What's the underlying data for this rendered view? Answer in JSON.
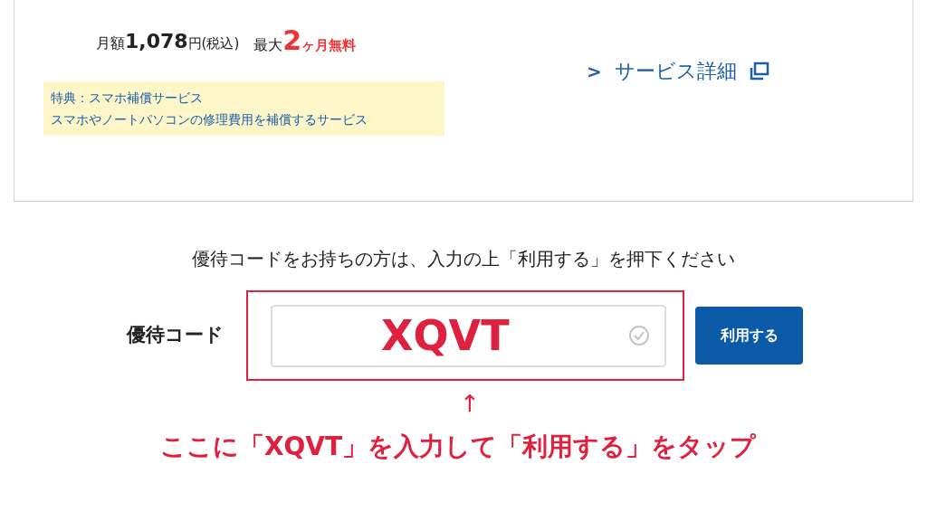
{
  "plan_card": {
    "price": {
      "prefix": "月額",
      "amount": "1,078",
      "suffix": "円(税込)"
    },
    "free_period": {
      "prefix": "最大",
      "number": "2",
      "suffix": "ヶ月無料"
    },
    "details_link": {
      "arrow": ">",
      "label": "サービス詳細"
    },
    "benefit": [
      "特典：スマホ補償サービス",
      "スマホやノートパソコンの修理費用を補償するサービス"
    ]
  },
  "instruction": "優待コードをお持ちの方は、入力の上「利用する」を押下ください",
  "coupon": {
    "label": "優待コード",
    "value": "XQVT",
    "valid": true,
    "button": "利用する"
  },
  "annotation": {
    "arrow": "↑",
    "text": "ここに「XQVT」を入力して「利用する」をタップ"
  }
}
